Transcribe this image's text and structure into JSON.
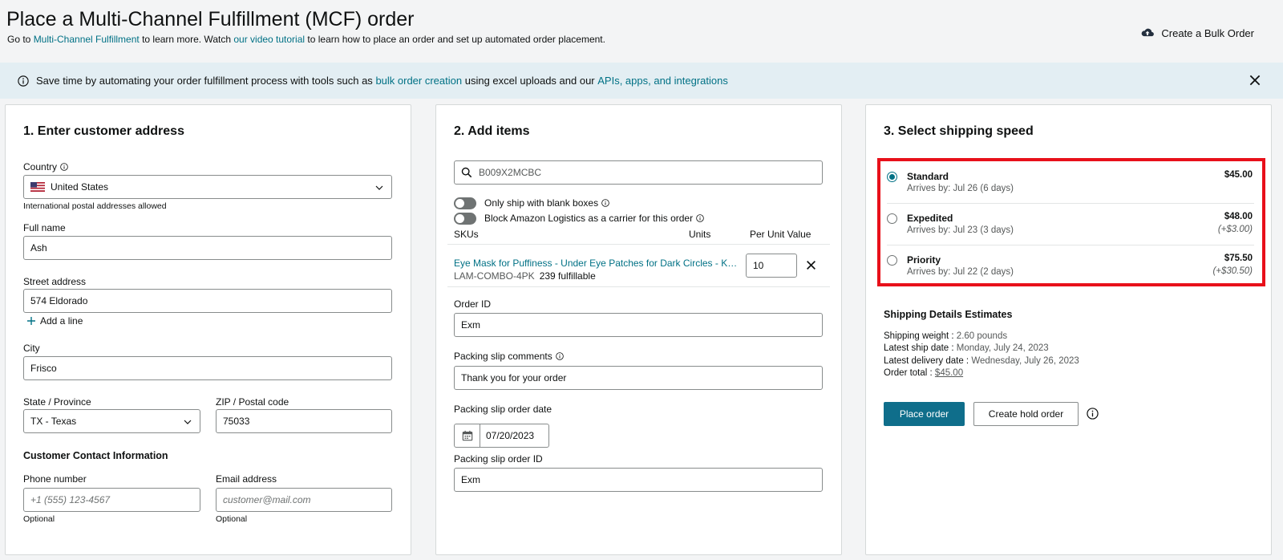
{
  "header": {
    "title": "Place a Multi-Channel Fulfillment (MCF) order",
    "sub_prefix": "Go to ",
    "sub_link1": "Multi-Channel Fulfillment",
    "sub_mid": " to learn more. Watch ",
    "sub_link2": "our video tutorial",
    "sub_suffix": " to learn how to place an order and set up automated order placement.",
    "bulk_label": "Create a Bulk Order"
  },
  "banner": {
    "prefix": "Save time by automating your order fulfillment process with tools such as ",
    "link1": "bulk order creation",
    "mid": " using excel uploads and our ",
    "link2": "APIs, apps, and integrations"
  },
  "address": {
    "title": "1. Enter customer address",
    "country_label": "Country",
    "country_value": "United States",
    "country_hint": "International postal addresses allowed",
    "name_label": "Full name",
    "name_value": "Ash",
    "street_label": "Street address",
    "street_value": "574 Eldorado",
    "add_line": "Add a line",
    "city_label": "City",
    "city_value": "Frisco",
    "state_label": "State / Province",
    "state_value": "TX - Texas",
    "zip_label": "ZIP / Postal code",
    "zip_value": "75033",
    "contact_title": "Customer Contact Information",
    "phone_label": "Phone number",
    "phone_placeholder": "+1 (555) 123-4567",
    "phone_hint": "Optional",
    "email_label": "Email address",
    "email_placeholder": "customer@mail.com",
    "email_hint": "Optional"
  },
  "items": {
    "title": "2. Add items",
    "search_value": "B009X2MCBC",
    "toggle1_label": "Only ship with blank boxes",
    "toggle2_label": "Block Amazon Logistics as a carrier for this order",
    "col_skus": "SKUs",
    "col_units": "Units",
    "col_value": "Per Unit Value",
    "sku_name": "Eye Mask for Puffiness - Under Eye Patches for Dark Circles - Korean...",
    "sku_code": "LAM-COMBO-4PK",
    "sku_fulfillable": "239 fulfillable",
    "sku_units": "10",
    "order_id_label": "Order ID",
    "order_id_value": "Exm",
    "comments_label": "Packing slip comments",
    "comments_value": "Thank you for your order",
    "date_label": "Packing slip order date",
    "date_value": "07/20/2023",
    "slip_id_label": "Packing slip order ID",
    "slip_id_value": "Exm"
  },
  "shipping": {
    "title": "3. Select shipping speed",
    "options": [
      {
        "name": "Standard",
        "arrives": "Arrives by: Jul 26 (6 days)",
        "price": "$45.00",
        "delta": ""
      },
      {
        "name": "Expedited",
        "arrives": "Arrives by: Jul 23 (3 days)",
        "price": "$48.00",
        "delta": "(+$3.00)"
      },
      {
        "name": "Priority",
        "arrives": "Arrives by: Jul 22 (2 days)",
        "price": "$75.50",
        "delta": "(+$30.50)"
      }
    ],
    "estimates_title": "Shipping Details Estimates",
    "weight_label": "Shipping weight :",
    "weight_value": "2.60 pounds",
    "ship_date_label": "Latest ship date :",
    "ship_date_value": "Monday, July 24, 2023",
    "delivery_label": "Latest delivery date :",
    "delivery_value": "Wednesday, July 26, 2023",
    "total_label": "Order total :",
    "total_value": "$45.00",
    "place_order": "Place order",
    "hold_order": "Create hold order"
  },
  "icons": {
    "info": "info-icon",
    "close": "close-icon",
    "cloud": "cloud-upload-icon",
    "search": "search-icon",
    "calendar": "calendar-icon",
    "plus": "plus-icon",
    "chevron": "chevron-down-icon",
    "flag": "us-flag-icon"
  },
  "colors": {
    "link": "#007185",
    "primary_button": "#0f6e8b",
    "highlight_border": "#e8101a",
    "banner_bg": "#e3eef3"
  }
}
